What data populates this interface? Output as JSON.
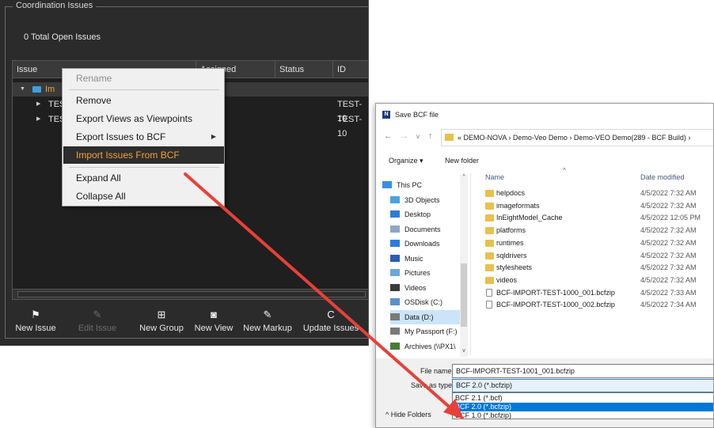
{
  "panel": {
    "group_title": "Coordination Issues",
    "open_issues": "0 Total Open Issues",
    "columns": [
      "Issue",
      "Assigned",
      "Status",
      "ID"
    ],
    "rows": [
      {
        "label": "Im",
        "id": ""
      },
      {
        "label": "TES",
        "id": "TEST-10"
      },
      {
        "label": "TES",
        "id": "TEST-10"
      }
    ],
    "toolbar": [
      {
        "label": "New Issue",
        "icon": "flag-icon",
        "glyph": "⚑",
        "enabled": true
      },
      {
        "label": "Edit Issue",
        "icon": "pencil-icon",
        "glyph": "✎",
        "enabled": false
      },
      {
        "label": "New Group",
        "icon": "add-group-icon",
        "glyph": "⊞",
        "enabled": true
      },
      {
        "label": "New View",
        "icon": "camera-icon",
        "glyph": "◙",
        "enabled": true
      },
      {
        "label": "New Markup",
        "icon": "markup-icon",
        "glyph": "✎",
        "enabled": true
      },
      {
        "label": "Update Issues",
        "icon": "refresh-icon",
        "glyph": "C",
        "enabled": true
      }
    ]
  },
  "context_menu": {
    "items": [
      {
        "label": "Rename",
        "state": "disabled"
      },
      {
        "label": "Remove",
        "state": "normal"
      },
      {
        "label": "Export Views as Viewpoints",
        "state": "normal"
      },
      {
        "label": "Export Issues to BCF",
        "state": "submenu"
      },
      {
        "label": "Import Issues From BCF",
        "state": "highlighted"
      },
      {
        "label": "Expand All",
        "state": "normal"
      },
      {
        "label": "Collapse All",
        "state": "normal"
      }
    ]
  },
  "dialog": {
    "title": "Save BCF file",
    "address": "« DEMO-NOVA › Demo-Veo Demo › Demo-VEO Demo(289 - BCF Build) ›",
    "organize": "Organize ▾",
    "new_folder": "New folder",
    "nav_items": [
      {
        "label": "This PC",
        "icon": "pc-icon",
        "color": "#3a8ee6"
      },
      {
        "label": "3D Objects",
        "icon": "cube-icon",
        "color": "#4aa3df"
      },
      {
        "label": "Desktop",
        "icon": "desktop-icon",
        "color": "#2e7bd6"
      },
      {
        "label": "Documents",
        "icon": "documents-icon",
        "color": "#8ea6c4"
      },
      {
        "label": "Downloads",
        "icon": "download-icon",
        "color": "#2e7bd6"
      },
      {
        "label": "Music",
        "icon": "music-icon",
        "color": "#2a5fb0"
      },
      {
        "label": "Pictures",
        "icon": "pictures-icon",
        "color": "#6aa8d8"
      },
      {
        "label": "Videos",
        "icon": "videos-icon",
        "color": "#3a3a3a"
      },
      {
        "label": "OSDisk (C:)",
        "icon": "drive-icon",
        "color": "#5a8fc8"
      },
      {
        "label": "Data (D:)",
        "icon": "drive-icon",
        "color": "#7a7a7a"
      },
      {
        "label": "My Passport (F:)",
        "icon": "drive-icon",
        "color": "#7a7a7a"
      },
      {
        "label": "Archives (\\\\PX1\\",
        "icon": "network-drive-icon",
        "color": "#4a7a3a"
      }
    ],
    "col_name": "Name",
    "col_date": "Date modified",
    "files": [
      {
        "name": "helpdocs",
        "date": "4/5/2022 7:32 AM",
        "kind": "folder"
      },
      {
        "name": "imageformats",
        "date": "4/5/2022 7:32 AM",
        "kind": "folder"
      },
      {
        "name": "InEightModel_Cache",
        "date": "4/5/2022 12:05 PM",
        "kind": "folder"
      },
      {
        "name": "platforms",
        "date": "4/5/2022 7:32 AM",
        "kind": "folder"
      },
      {
        "name": "runtimes",
        "date": "4/5/2022 7:32 AM",
        "kind": "folder"
      },
      {
        "name": "sqldrivers",
        "date": "4/5/2022 7:32 AM",
        "kind": "folder"
      },
      {
        "name": "stylesheets",
        "date": "4/5/2022 7:32 AM",
        "kind": "folder"
      },
      {
        "name": "videos",
        "date": "4/5/2022 7:32 AM",
        "kind": "folder"
      },
      {
        "name": "BCF-IMPORT-TEST-1000_001.bcfzip",
        "date": "4/5/2022 7:33 AM",
        "kind": "file"
      },
      {
        "name": "BCF-IMPORT-TEST-1000_002.bcfzip",
        "date": "4/5/2022 7:34 AM",
        "kind": "file"
      }
    ],
    "file_name_label": "File name:",
    "file_name_value": "BCF-IMPORT-TEST-1001_001.bcfzip",
    "save_type_label": "Save as type:",
    "save_type_value": "BCF 2.0 (*.bcfzip)",
    "type_options": [
      {
        "label": "BCF 2.1 (*.bcf)",
        "selected": false
      },
      {
        "label": "BCF 2.0 (*.bcfzip)",
        "selected": true
      },
      {
        "label": "BCF 1.0 (*.bcfzip)",
        "selected": false
      }
    ],
    "hide_folders": "^  Hide Folders"
  },
  "colors": {
    "panel_bg": "#2b2b2b",
    "highlight_text": "#f1a33a",
    "arrow": "#e8403a",
    "selection": "#0078d7"
  }
}
